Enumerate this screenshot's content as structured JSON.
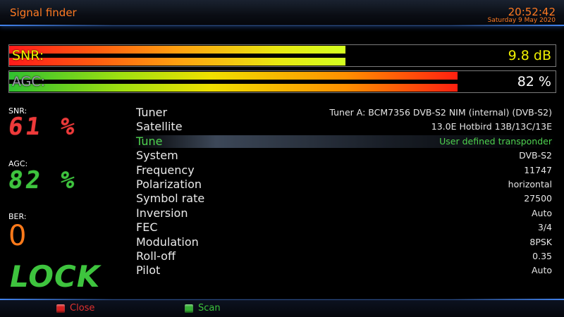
{
  "header": {
    "title": "Signal finder",
    "time": "20:52:42",
    "date": "Saturday  9 May 2020"
  },
  "bars": {
    "snr": {
      "label": "SNR:",
      "value": "9.8 dB",
      "fill_fraction": 0.615
    },
    "agc": {
      "label": "AGC:",
      "value": "82 %",
      "fill_fraction": 0.82
    }
  },
  "left": {
    "snr_label": "SNR:",
    "snr_value": "61 %",
    "agc_label": "AGC:",
    "agc_value": "82 %",
    "ber_label": "BER:",
    "ber_value": "0",
    "lock": "LOCK"
  },
  "params": [
    {
      "key": "Tuner",
      "value": "Tuner A: BCM7356 DVB-S2 NIM (internal) (DVB-S2)",
      "selected": false
    },
    {
      "key": "Satellite",
      "value": "13.0E Hotbird 13B/13C/13E",
      "selected": false
    },
    {
      "key": "Tune",
      "value": "User defined transponder",
      "selected": true
    },
    {
      "key": "System",
      "value": "DVB-S2",
      "selected": false
    },
    {
      "key": "Frequency",
      "value": "11747",
      "selected": false
    },
    {
      "key": "Polarization",
      "value": "horizontal",
      "selected": false
    },
    {
      "key": "Symbol rate",
      "value": "27500",
      "selected": false
    },
    {
      "key": "Inversion",
      "value": "Auto",
      "selected": false
    },
    {
      "key": "FEC",
      "value": "3/4",
      "selected": false
    },
    {
      "key": "Modulation",
      "value": "8PSK",
      "selected": false
    },
    {
      "key": "Roll-off",
      "value": "0.35",
      "selected": false
    },
    {
      "key": "Pilot",
      "value": "Auto",
      "selected": false
    }
  ],
  "footer": {
    "close_label": "Close",
    "scan_label": "Scan"
  },
  "colors": {
    "accent_orange": "#ff7a22",
    "snr_red": "#ee3a3a",
    "agc_green": "#3ec43e",
    "ber_orange": "#ff7a1a",
    "selected_green": "#4fd24f"
  }
}
